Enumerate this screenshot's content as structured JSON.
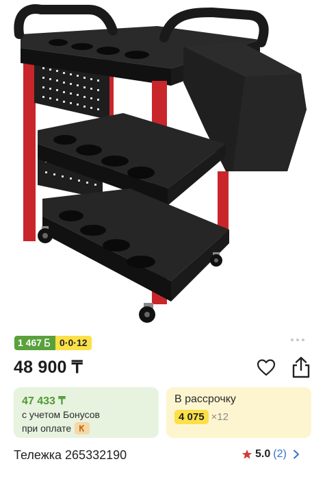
{
  "product_image": {
    "icon": "utility-cart-image"
  },
  "badges": {
    "bonus_value": "1 467",
    "installment": "0·0·12"
  },
  "price": "48 900 ₸",
  "bonus_card": {
    "amount": "47 433 ₸",
    "line1": "с учетом Бонусов",
    "line2": "при оплате"
  },
  "installment_card": {
    "title": "В рассрочку",
    "monthly": "4 075",
    "multiplier": "×12"
  },
  "product": {
    "title": "Тележка 265332190"
  },
  "rating": {
    "value": "5.0",
    "count": "(2)"
  },
  "colors": {
    "green": "#59a13b",
    "yellow": "#fbe047",
    "red": "#d33a3a",
    "link": "#3270c8"
  }
}
